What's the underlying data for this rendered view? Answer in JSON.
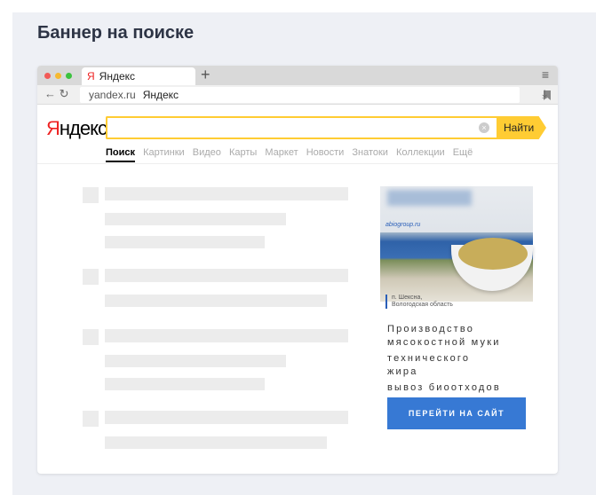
{
  "page_title": "Баннер на поиске",
  "browser": {
    "tab_label": "Яндекс",
    "tab_icon": "Я",
    "new_tab": "+",
    "menu": "≡",
    "url": "yandex.ru",
    "url_title": "Яндекс",
    "back": "←",
    "reload": "↻",
    "download": "⤓"
  },
  "yandex": {
    "logo_first": "Я",
    "logo_rest": "ндекс",
    "search_value": "",
    "find_button": "Найти",
    "tabs": [
      "Поиск",
      "Картинки",
      "Видео",
      "Карты",
      "Маркет",
      "Новости",
      "Знатоки",
      "Коллекции",
      "Ещё"
    ]
  },
  "ad": {
    "site": "abiogroup.ru",
    "location_1": "п. Шексна,",
    "location_2": "Вологодская область",
    "lines": [
      "Производство",
      "мясокостной муки",
      "технического",
      "жира",
      "вывоз биоотходов"
    ],
    "button": "ПЕРЕЙТИ НА САЙТ"
  },
  "colors": {
    "accent": "#ffcc33",
    "button": "#3779d4",
    "brand_red": "#ee2222"
  }
}
